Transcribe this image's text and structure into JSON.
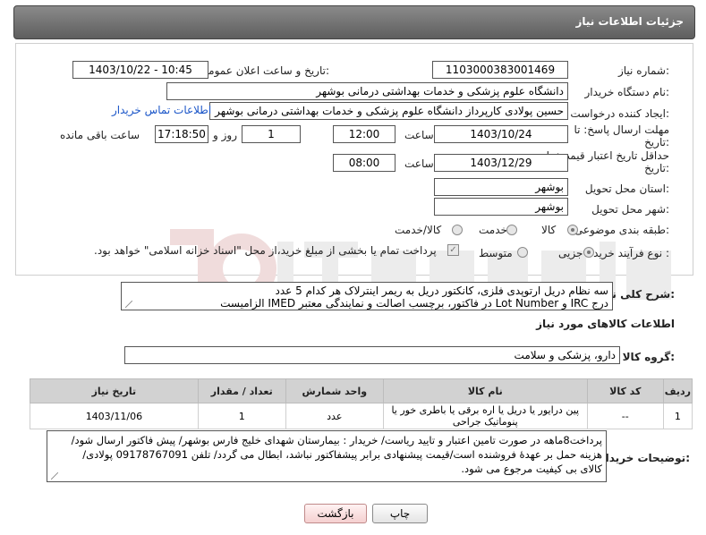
{
  "header": {
    "title": "جزئیات اطلاعات نیاز"
  },
  "form": {
    "need_number": {
      "label": "شماره نیاز:",
      "value": "1103000383001469"
    },
    "announce": {
      "label": "تاریخ و ساعت اعلان عمومی:",
      "value": "1403/10/22 - 10:45"
    },
    "buyer_org": {
      "label": "نام دستگاه خریدار:",
      "value": "دانشگاه علوم پزشکی و خدمات بهداشتی درمانی بوشهر"
    },
    "creator": {
      "label": "ایجاد کننده درخواست:",
      "value": "حسین پولادی کارپرداز دانشگاه علوم پزشکی و خدمات بهداشتی درمانی بوشهر",
      "contact_link": "اطلاعات تماس خریدار"
    },
    "response_deadline": {
      "label_line1": "مهلت ارسال پاسخ: تا",
      "label_line2": "تاریخ:",
      "date": "1403/10/24",
      "time_label": "ساعت",
      "time": "12:00",
      "days": "1",
      "days_label": "روز و",
      "remaining_time": "17:18:50",
      "remaining_label": "ساعت باقی مانده"
    },
    "price_validity": {
      "label_line1": "حداقل تاریخ اعتبار قیمت: تا",
      "label_line2": "تاریخ:",
      "date": "1403/12/29",
      "time_label": "ساعت",
      "time": "08:00"
    },
    "province": {
      "label": "استان محل تحویل:",
      "value": "بوشهر"
    },
    "city": {
      "label": "شهر محل تحویل:",
      "value": "بوشهر"
    },
    "category": {
      "label": "طبقه بندی موضوعی:",
      "options": [
        "کالا",
        "خدمت",
        "کالا/خدمت"
      ],
      "selected": "کالا"
    },
    "process": {
      "label": "نوع فرآیند خرید :",
      "options": [
        "جزیی",
        "متوسط"
      ],
      "selected": "جزیی",
      "payment_note": "پرداخت تمام یا بخشی از مبلغ خرید،از محل \"اسناد خزانه اسلامی\" خواهد بود."
    }
  },
  "general_description": {
    "label": "شرح کلی نیاز:",
    "line1": "سه نظام دریل ارتوپدی فلزی، کانکتور دریل به ریمر اینترلاک هر کدام 5 عدد",
    "line2": "درج IRC و Lot Number در فاکتور، برچسب اصالت و نمایندگی معتبر IMED الزامیست"
  },
  "goods_section": {
    "title": "اطلاعات کالاهای مورد نیاز",
    "group_label": "گروه کالا:",
    "group_value": "دارو، پزشکی و سلامت",
    "columns": [
      "ردیف",
      "کد کالا",
      "نام کالا",
      "واحد شمارش",
      "تعداد / مقدار",
      "تاریخ نیاز"
    ],
    "rows": [
      {
        "row": "1",
        "code": "--",
        "name": "پین درایور یا دریل یا اره برقی یا باطری خور یا پنوماتیک جراحی",
        "unit": "عدد",
        "qty": "1",
        "date": "1403/11/06"
      }
    ]
  },
  "buyer_notes": {
    "label": "توضیحات خریدار:",
    "line1": "پرداخت8ماهه در صورت تامین اعتبار و تایید ریاست/ خریدار : بیمارستان شهدای خلیج فارس بوشهر/ پیش فاکتور ارسال شود/",
    "line2": "هزینه حمل بر عهدهٔ فروشنده است/قیمت پیشنهادی برابر پیشفاکتور نباشد، ابطال می گردد/ تلفن 09178767091 پولادی/",
    "line3": "کالای بی کیفیت مرجوع می شود."
  },
  "buttons": {
    "print": "چاپ",
    "back": "بازگشت"
  },
  "colors": {
    "header_bg": "#6f6f6f",
    "link": "#1a55c8",
    "table_header": "#d2d2d2",
    "back_button": "#f5d0d0"
  }
}
